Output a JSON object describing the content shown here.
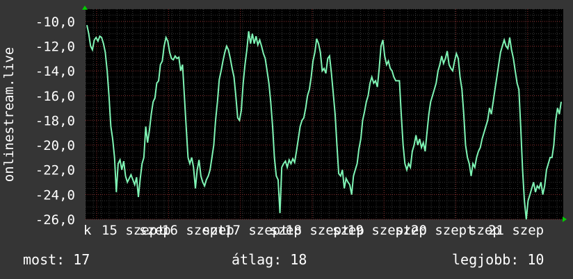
{
  "colors": {
    "background": "#353535",
    "plot_background": "#000000",
    "line": "#7ff5b5",
    "grid_major": "#8a2a2a",
    "grid_minor": "#3a3a3a",
    "arrow": "#00cc00",
    "text": "#ffffff"
  },
  "chart_data": {
    "type": "line",
    "ylabel": "onlinestream.live",
    "ylim": [
      -26,
      -9
    ],
    "yticks": [
      "-10,0",
      "-12,0",
      "-14,0",
      "-16,0",
      "-18,0",
      "-20,0",
      "-22,0",
      "-24,0",
      "-26,0"
    ],
    "ytick_values": [
      -10,
      -12,
      -14,
      -16,
      -18,
      -20,
      -22,
      -24,
      -26
    ],
    "xticks": [
      "k",
      "15 szept",
      "szep",
      "16 szept",
      "szep",
      "17 szept",
      "szep",
      "18 szept",
      "szep",
      "19 szept",
      "szep",
      "20 szept",
      "szep",
      "21 szep"
    ],
    "grid": true,
    "series": [
      {
        "values": [
          -10.3,
          -11.0,
          -12.0,
          -12.3,
          -11.5,
          -11.3,
          -11.6,
          -11.2,
          -11.3,
          -11.8,
          -12.5,
          -14.0,
          -16.0,
          -18.5,
          -19.5,
          -21.0,
          -23.8,
          -21.5,
          -21.2,
          -22.0,
          -21.3,
          -22.5,
          -23.0,
          -22.7,
          -22.4,
          -22.8,
          -23.2,
          -22.6,
          -24.2,
          -22.7,
          -21.5,
          -21.0,
          -18.5,
          -19.8,
          -18.8,
          -17.5,
          -16.5,
          -16.2,
          -15.0,
          -14.8,
          -13.5,
          -13.2,
          -12.0,
          -11.3,
          -11.6,
          -12.5,
          -13.0,
          -13.1,
          -12.8,
          -13.0,
          -12.9,
          -14.0,
          -13.5,
          -16.0,
          -18.5,
          -21.0,
          -21.5,
          -21.0,
          -21.8,
          -23.5,
          -22.0,
          -21.2,
          -22.5,
          -23.0,
          -23.3,
          -22.8,
          -22.5,
          -22.0,
          -21.0,
          -20.0,
          -18.0,
          -16.5,
          -14.7,
          -14.0,
          -13.2,
          -12.5,
          -12.0,
          -12.3,
          -13.0,
          -13.8,
          -14.5,
          -16.0,
          -17.8,
          -18.0,
          -17.2,
          -15.0,
          -13.5,
          -12.3,
          -10.8,
          -11.8,
          -11.0,
          -11.8,
          -11.2,
          -11.9,
          -11.5,
          -12.0,
          -12.6,
          -13.0,
          -14.0,
          -15.0,
          -16.5,
          -18.5,
          -21.0,
          -22.5,
          -22.8,
          -25.5,
          -21.8,
          -21.5,
          -21.3,
          -21.8,
          -21.2,
          -21.5,
          -21.1,
          -21.4,
          -20.5,
          -19.5,
          -18.5,
          -18.0,
          -17.8,
          -17.0,
          -16.0,
          -15.5,
          -14.5,
          -13.2,
          -12.5,
          -11.4,
          -11.8,
          -12.5,
          -14.0,
          -13.8,
          -14.2,
          -13.0,
          -12.8,
          -14.2,
          -15.8,
          -17.5,
          -20.0,
          -22.3,
          -22.5,
          -22.0,
          -23.5,
          -22.7,
          -23.0,
          -23.2,
          -24.0,
          -22.5,
          -22.0,
          -21.5,
          -20.3,
          -19.5,
          -18.0,
          -17.3,
          -16.5,
          -16.0,
          -15.0,
          -14.5,
          -15.0,
          -14.8,
          -15.3,
          -13.8,
          -12.0,
          -11.5,
          -12.8,
          -13.5,
          -13.2,
          -13.8,
          -14.0,
          -14.5,
          -14.8,
          -14.8,
          -14.8,
          -17.5,
          -20.0,
          -21.5,
          -22.0,
          -21.5,
          -21.8,
          -20.5,
          -20.0,
          -19.2,
          -20.0,
          -19.5,
          -20.2,
          -19.8,
          -20.5,
          -19.0,
          -17.5,
          -16.5,
          -16.0,
          -15.5,
          -15.0,
          -14.0,
          -13.5,
          -12.8,
          -13.4,
          -13.0,
          -12.4,
          -13.5,
          -13.8,
          -14.0,
          -13.2,
          -12.6,
          -13.0,
          -14.5,
          -15.5,
          -17.5,
          -20.0,
          -21.0,
          -21.5,
          -22.5,
          -21.5,
          -21.8,
          -21.0,
          -20.5,
          -20.2,
          -19.5,
          -19.0,
          -18.5,
          -18.0,
          -17.0,
          -17.5,
          -16.5,
          -15.5,
          -14.5,
          -13.5,
          -12.5,
          -12.0,
          -11.5,
          -12.0,
          -12.2,
          -11.3,
          -12.3,
          -13.0,
          -14.0,
          -15.0,
          -15.5,
          -18.5,
          -22.0,
          -24.5,
          -26.0,
          -24.5,
          -24.0,
          -23.5,
          -23.0,
          -23.8,
          -23.3,
          -23.5,
          -23.0,
          -24.0,
          -23.3,
          -22.0,
          -21.5,
          -21.0,
          -21.0,
          -20.0,
          -18.0,
          -17.0,
          -17.5,
          -16.5
        ]
      }
    ]
  },
  "stats": {
    "now": "most: 17",
    "avg": "átlag: 18",
    "best": "legjobb: 10"
  }
}
